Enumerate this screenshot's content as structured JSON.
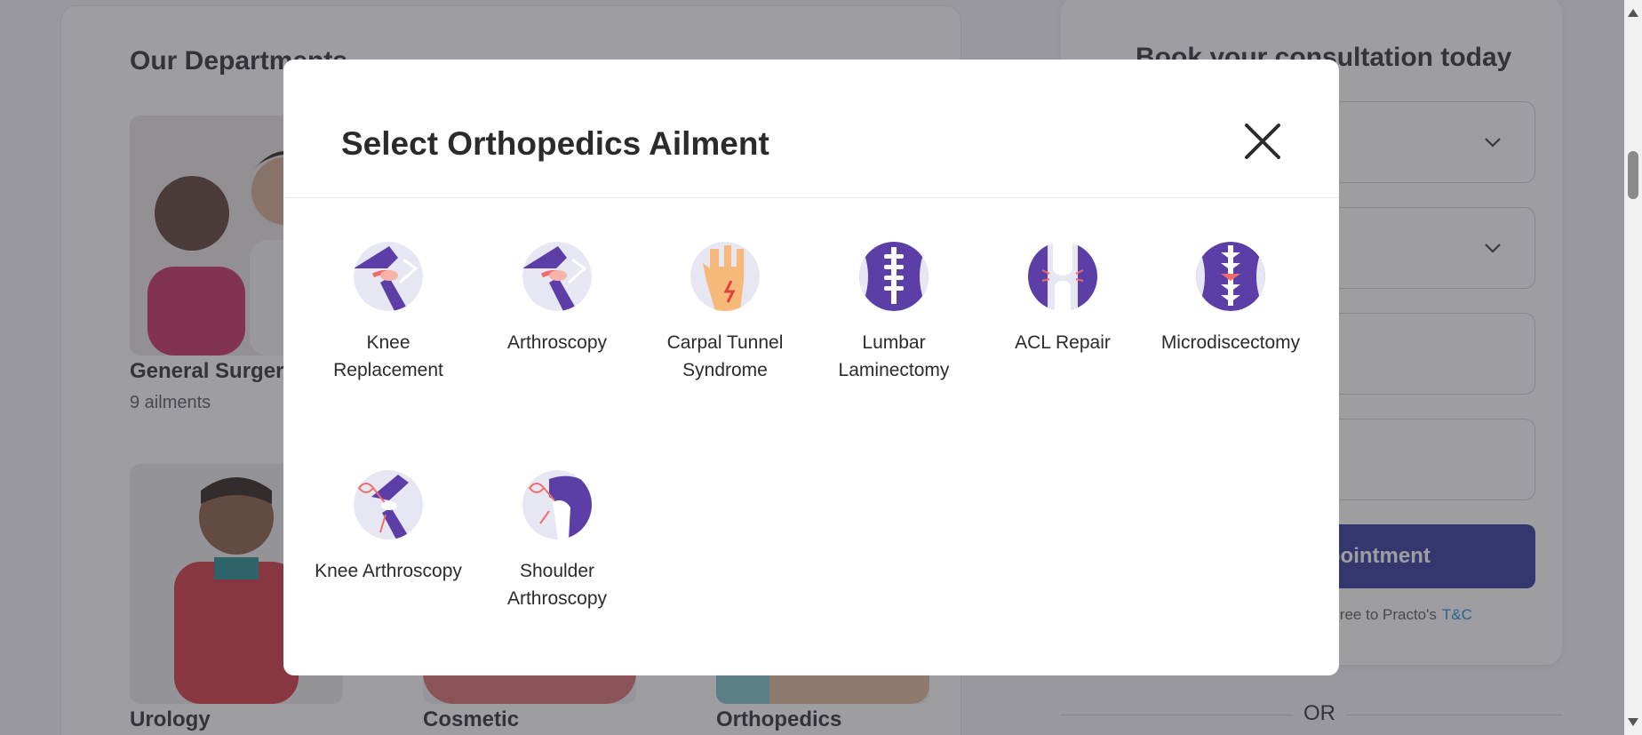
{
  "departments": {
    "title": "Our Departments",
    "items": [
      {
        "name": "General Surgery",
        "count": "9 ailments"
      },
      {
        "name": "Urology"
      },
      {
        "name": "Cosmetic"
      },
      {
        "name": "Orthopedics"
      }
    ]
  },
  "booking": {
    "title": "Book your consultation today",
    "button_label": "Book Appointment",
    "terms_text": "By submitting you agree to Practo's",
    "terms_link": "T&C",
    "or_text": "OR"
  },
  "modal": {
    "title": "Select Orthopedics Ailment",
    "ailments": [
      {
        "label": "Knee Replacement",
        "icon": "knee-replacement-icon"
      },
      {
        "label": "Arthroscopy",
        "icon": "arthroscopy-icon"
      },
      {
        "label": "Carpal Tunnel Syndrome",
        "icon": "carpal-tunnel-icon"
      },
      {
        "label": "Lumbar Laminectomy",
        "icon": "lumbar-laminectomy-icon"
      },
      {
        "label": "ACL Repair",
        "icon": "acl-repair-icon"
      },
      {
        "label": "Microdiscectomy",
        "icon": "microdiscectomy-icon"
      },
      {
        "label": "Knee Arthroscopy",
        "icon": "knee-arthroscopy-icon"
      },
      {
        "label": "Shoulder Arthroscopy",
        "icon": "shoulder-arthroscopy-icon"
      }
    ]
  },
  "colors": {
    "accent": "#2d3294",
    "icon_purple": "#5b3ea6",
    "icon_bg": "#e6e7f2",
    "icon_coral": "#f06c6c",
    "link": "#1a8cd8"
  }
}
